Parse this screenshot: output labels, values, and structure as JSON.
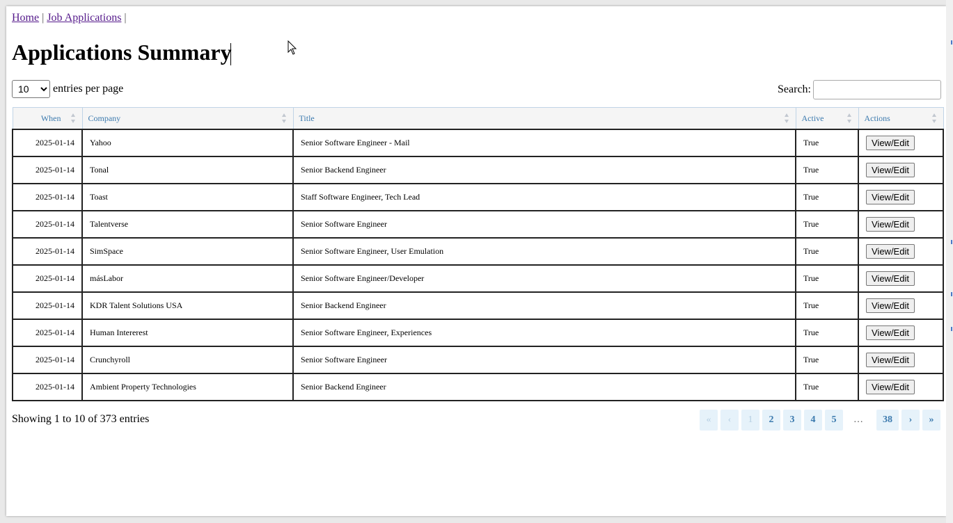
{
  "breadcrumb": {
    "home": "Home",
    "separator": "|",
    "job_applications": "Job Applications"
  },
  "page_title": "Applications Summary",
  "length_control": {
    "selected": "10",
    "label": "entries per page"
  },
  "search": {
    "label": "Search:",
    "value": ""
  },
  "table": {
    "columns": [
      "When",
      "Company",
      "Title",
      "Active",
      "Actions"
    ],
    "rows": [
      {
        "when": "2025-01-14",
        "company": "Yahoo",
        "title": "Senior Software Engineer - Mail",
        "active": "True",
        "action": "View/Edit"
      },
      {
        "when": "2025-01-14",
        "company": "Tonal",
        "title": "Senior Backend Engineer",
        "active": "True",
        "action": "View/Edit"
      },
      {
        "when": "2025-01-14",
        "company": "Toast",
        "title": "Staff Software Engineer, Tech Lead",
        "active": "True",
        "action": "View/Edit"
      },
      {
        "when": "2025-01-14",
        "company": "Talentverse",
        "title": "Senior Software Engineer",
        "active": "True",
        "action": "View/Edit"
      },
      {
        "when": "2025-01-14",
        "company": "SimSpace",
        "title": "Senior Software Engineer, User Emulation",
        "active": "True",
        "action": "View/Edit"
      },
      {
        "when": "2025-01-14",
        "company": "másLabor",
        "title": "Senior Software Engineer/Developer",
        "active": "True",
        "action": "View/Edit"
      },
      {
        "when": "2025-01-14",
        "company": "KDR Talent Solutions USA",
        "title": "Senior Backend Engineer",
        "active": "True",
        "action": "View/Edit"
      },
      {
        "when": "2025-01-14",
        "company": "Human Intererest",
        "title": "Senior Software Engineer, Experiences",
        "active": "True",
        "action": "View/Edit"
      },
      {
        "when": "2025-01-14",
        "company": "Crunchyroll",
        "title": "Senior Software Engineer",
        "active": "True",
        "action": "View/Edit"
      },
      {
        "when": "2025-01-14",
        "company": "Ambient Property Technologies",
        "title": "Senior Backend Engineer",
        "active": "True",
        "action": "View/Edit"
      }
    ]
  },
  "info": "Showing 1 to 10 of 373 entries",
  "pagination": {
    "first": "«",
    "prev": "‹",
    "pages": [
      "1",
      "2",
      "3",
      "4",
      "5"
    ],
    "ellipsis": "…",
    "last_page": "38",
    "next": "›",
    "last": "»"
  }
}
